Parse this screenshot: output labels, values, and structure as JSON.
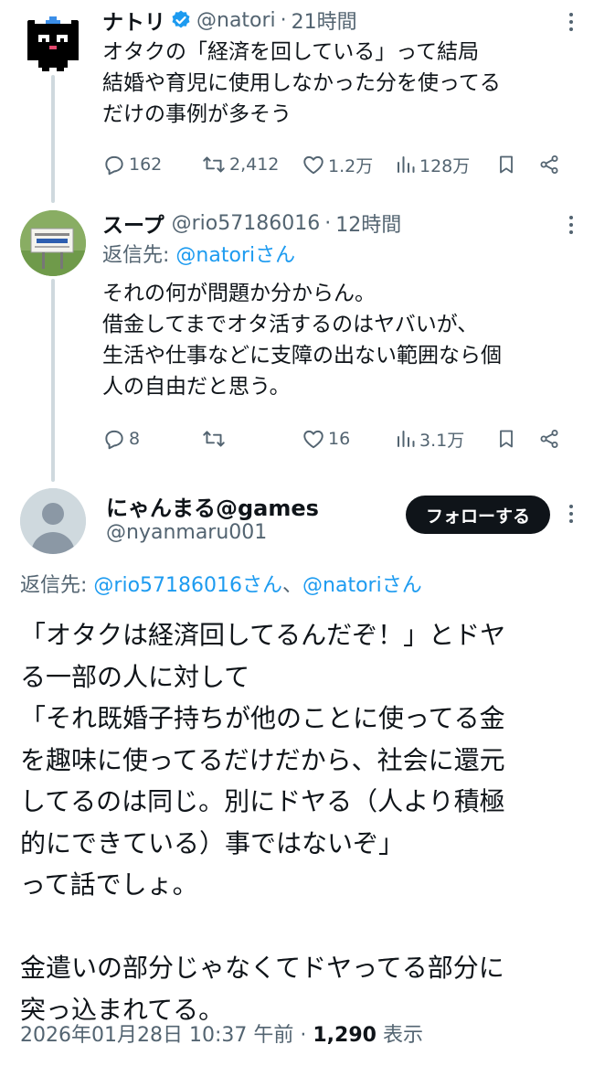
{
  "tweets": [
    {
      "name": "ナトリ",
      "handle": "@natori",
      "sep": "·",
      "time": "21時間",
      "lines": [
        "オタクの「経済を回している」って結局",
        "結婚や育児に使用しなかった分を使ってる",
        "だけの事例が多そう"
      ],
      "replies": "162",
      "retweets": "2,412",
      "likes": "1.2万",
      "views": "128万"
    },
    {
      "name": "スープ",
      "handle": "@rio57186016",
      "sep": "·",
      "time": "12時間",
      "replying_prefix": "返信先: ",
      "replying_link": "@natoriさん",
      "lines": [
        "それの何が問題か分からん。",
        "借金してまでオタ活するのはヤバいが、",
        "生活や仕事などに支障の出ない範囲なら個",
        "人の自由だと思う。"
      ],
      "replies": "8",
      "retweets": "",
      "likes": "16",
      "views": "3.1万"
    }
  ],
  "main": {
    "name": "にゃんまる@games",
    "handle": "@nyanmaru001",
    "follow_label": "フォローする",
    "replying_prefix": "返信先: ",
    "replying_link1": "@rio57186016さん",
    "replying_sep": "、",
    "replying_link2": "@natoriさん",
    "lines": [
      "「オタクは経済回してるんだぞ！」とドヤ",
      "る一部の人に対して",
      "「それ既婚子持ちが他のことに使ってる金",
      "を趣味に使ってるだけだから、社会に還元",
      "してるのは同じ。別にドヤる（人より積極",
      "的にできている）事ではないぞ」",
      "って話でしょ。",
      "",
      "金遣いの部分じゃなくてドヤってる部分に",
      "突っ込まれてる。"
    ],
    "timestamp": "2026年01月28日 10:37 午前",
    "meta_sep": " · ",
    "views": "1,290",
    "views_label": " 表示"
  },
  "colors": {
    "link": "#1d9bf0",
    "muted": "#536471",
    "verified": "#1d9bf0",
    "text": "#0f1419"
  },
  "icons": [
    "reply-icon",
    "retweet-icon",
    "like-icon",
    "views-icon",
    "bookmark-icon",
    "share-icon",
    "verified-icon",
    "more-icon"
  ]
}
